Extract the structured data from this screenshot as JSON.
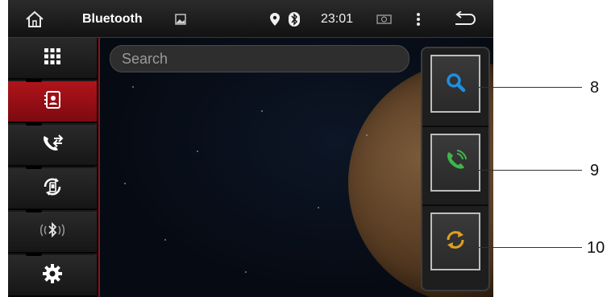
{
  "statusbar": {
    "title": "Bluetooth",
    "time": "23:01",
    "icons": [
      "home-icon",
      "image-icon",
      "location-icon",
      "bluetooth-icon",
      "battery-icon",
      "menu-icon",
      "back-icon"
    ]
  },
  "sidebar": {
    "items": [
      {
        "icon": "apps-grid-icon",
        "active": false
      },
      {
        "icon": "contacts-icon",
        "active": true
      },
      {
        "icon": "call-log-icon",
        "active": false
      },
      {
        "icon": "phone-sync-icon",
        "active": false
      },
      {
        "icon": "bluetooth-connect-icon",
        "active": false
      },
      {
        "icon": "settings-gear-icon",
        "active": false
      }
    ]
  },
  "search": {
    "placeholder": "Search"
  },
  "actions": {
    "buttons": [
      {
        "icon": "search-icon",
        "color": "#1e8fe0"
      },
      {
        "icon": "phone-call-icon",
        "color": "#3fb54a"
      },
      {
        "icon": "sync-icon",
        "color": "#e0a020"
      }
    ]
  },
  "callouts": [
    "8",
    "9",
    "10"
  ],
  "colors": {
    "accent_red": "#b0141b",
    "sidebar": "#191919"
  }
}
